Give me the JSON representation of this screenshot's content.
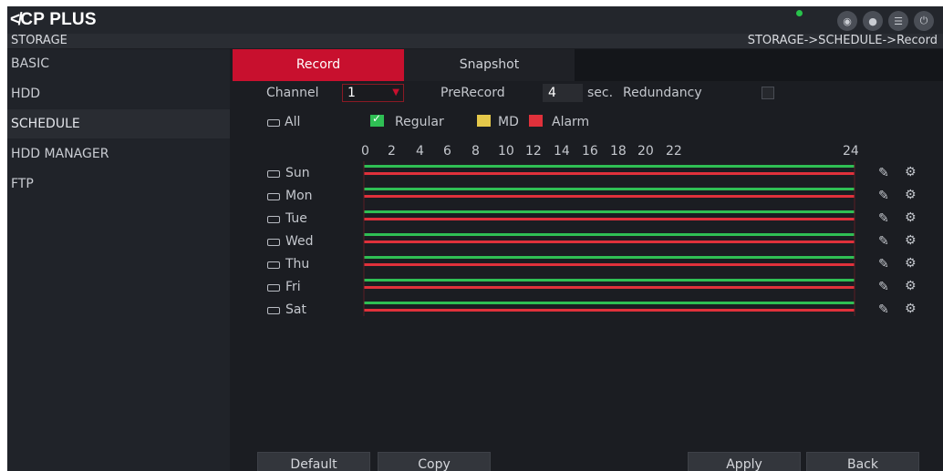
{
  "app": {
    "brand": "CP PLUS",
    "section": "STORAGE",
    "breadcrumb": "STORAGE->SCHEDULE->Record"
  },
  "top_icons": [
    "eye-icon",
    "user-icon",
    "menu-icon",
    "power-icon"
  ],
  "sidebar": {
    "items": [
      {
        "label": "BASIC",
        "active": false
      },
      {
        "label": "HDD",
        "active": false
      },
      {
        "label": "SCHEDULE",
        "active": true
      },
      {
        "label": "HDD MANAGER",
        "active": false
      },
      {
        "label": "FTP",
        "active": false
      }
    ]
  },
  "tabs": [
    {
      "label": "Record",
      "active": true
    },
    {
      "label": "Snapshot",
      "active": false
    }
  ],
  "form": {
    "channel_label": "Channel",
    "channel_value": "1",
    "prerecord_label": "PreRecord",
    "prerecord_value": "4",
    "sec_label": "sec.",
    "redundancy_label": "Redundancy",
    "all_label": "All"
  },
  "legend": [
    {
      "label": "Regular",
      "color": "#2fbf54"
    },
    {
      "label": "MD",
      "color": "#e5c84a"
    },
    {
      "label": "Alarm",
      "color": "#e0313b"
    }
  ],
  "hours": [
    "0",
    "2",
    "4",
    "6",
    "8",
    "10",
    "12",
    "14",
    "16",
    "18",
    "20",
    "22",
    "24"
  ],
  "days": [
    "Sun",
    "Mon",
    "Tue",
    "Wed",
    "Thu",
    "Fri",
    "Sat"
  ],
  "buttons": {
    "default": "Default",
    "copy": "Copy",
    "apply": "Apply",
    "back": "Back"
  },
  "colors": {
    "accent": "#c8102e",
    "regular_bar": "#2fbf54",
    "alarm_bar": "#e0313b"
  }
}
